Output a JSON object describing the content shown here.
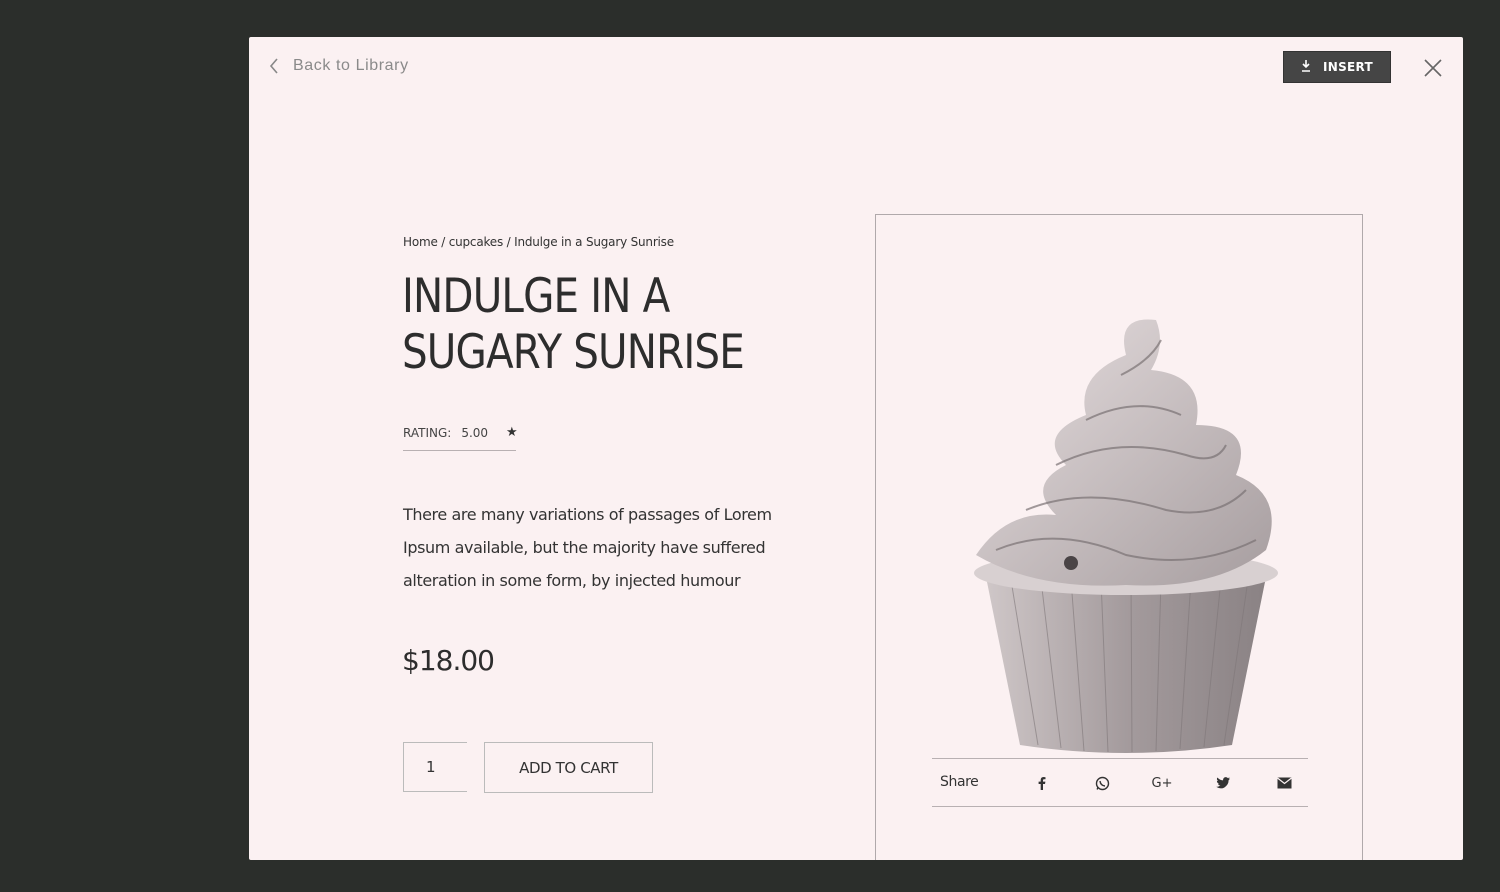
{
  "modal": {
    "back_label": "Back to Library",
    "insert_label": "INSERT"
  },
  "product": {
    "breadcrumb": "Home / cupcakes / Indulge in a Sugary Sunrise",
    "title_line1": "INDULGE IN A",
    "title_line2": "SUGARY SUNRISE",
    "rating_label": "RATING:",
    "rating_value": "5.00",
    "description": "There are many variations of passages of Lorem Ipsum available, but the majority have suffered alteration in some form, by injected humour",
    "price": "$18.00",
    "quantity": "1",
    "add_to_cart_label": "ADD TO CART"
  },
  "share": {
    "label": "Share",
    "icons": [
      "facebook-icon",
      "whatsapp-icon",
      "google-plus-icon",
      "twitter-icon",
      "email-icon"
    ],
    "gplus_text": "G+"
  },
  "colors": {
    "overlay": "#2b2e2b",
    "modal_bg": "#fbf1f2",
    "text": "#2d2d2d",
    "insert_bg": "#454545"
  }
}
